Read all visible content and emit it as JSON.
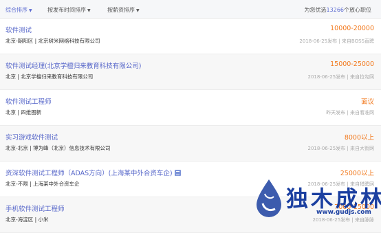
{
  "sort_bar": {
    "items": [
      {
        "label": "综合排序"
      },
      {
        "label": "按发布时间排序"
      },
      {
        "label": "按薪资排序"
      }
    ],
    "arrow_icon": "sort-down-arrow-icon",
    "result_prefix": "为您优选",
    "result_count": "13266",
    "result_suffix": "个放心职位"
  },
  "jobs": [
    {
      "title": "软件测试",
      "salary": "10000-20000",
      "company": "北京-朝阳区 |  北京树米网络科技有限公司",
      "meta": "2018-06-25发布  |  来自BOSS直聘"
    },
    {
      "title": "软件测试经理(北京学檀归来教育科技有限公司)",
      "salary": "15000-25000",
      "company": "北京 |  北京学檀归来教育科技有限公司",
      "meta": "2018-06-25发布  |  来自拉勾网"
    },
    {
      "title": "软件测试工程师",
      "salary": "面议",
      "company": "北京 |  四维图新",
      "meta": "昨天发布  |  来自看准网"
    },
    {
      "title": "实习游戏软件测试",
      "salary": "8000以上",
      "company": "北京-北京 |  博为峰（北京）信息技术有限公司",
      "meta": "2018-06-25发布  |  来自大街网"
    },
    {
      "title": "资深软件测试工程师（ADAS方向）(上海某中外合资车企)",
      "salary": "25000以上",
      "company": "北京-不限 |  上海某中外合资车企",
      "meta": "2018-06-25发布  |  来自猎聘网"
    },
    {
      "title": "手机软件测试工程师",
      "salary": "7000-15000",
      "company": "北京-海淀区 |  小米",
      "meta": "2018-06-25发布  |  来自脉脉"
    }
  ],
  "watermark": {
    "text": "独木成林",
    "url": "www.gudjs.com",
    "logo_icon": "water-drop-logo-icon"
  },
  "colors": {
    "accent": "#5c6bd1",
    "title": "#5565c9",
    "salary": "#f27a1f",
    "meta": "#aaaaaa",
    "watermark": "#1b3fa0"
  }
}
